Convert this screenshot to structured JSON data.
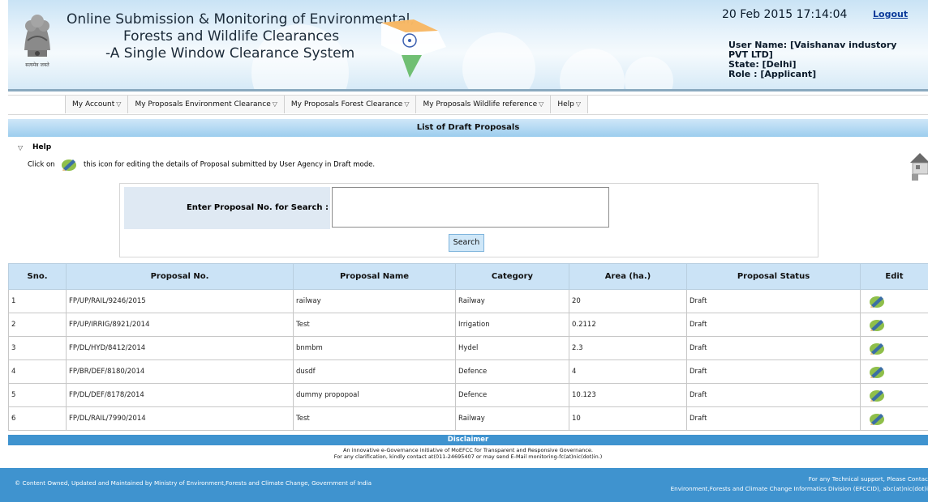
{
  "header": {
    "title_lines": [
      "Online Submission & Monitoring of Environmental,",
      "Forests and Wildlife Clearances",
      "-A Single Window Clearance System"
    ],
    "emblem_caption": "सत्यमेव जयते",
    "datetime": "20 Feb 2015 17:14:04",
    "logout_label": "Logout",
    "user_name": "User Name: [Vaishanav industory",
    "user_name_cont": "PVT LTD]",
    "state": "State: [Delhi]",
    "role": "Role : [Applicant]"
  },
  "menu": [
    {
      "label": "My Account",
      "icon": "chevron-down-icon"
    },
    {
      "label": "My Proposals Environment Clearance",
      "icon": "chevron-down-icon"
    },
    {
      "label": "My Proposals Forest Clearance",
      "icon": "chevron-down-icon"
    },
    {
      "label": "My Proposals Wildlife reference",
      "icon": "chevron-down-icon"
    },
    {
      "label": "Help",
      "icon": "chevron-down-icon"
    }
  ],
  "section_title": "List of Draft Proposals",
  "help": {
    "title": "Help",
    "text_before": "Click on",
    "text_after": "this icon for editing the details of Proposal submitted by User Agency in Draft mode."
  },
  "search": {
    "label": "Enter Proposal No. for Search :",
    "value": "",
    "button_label": "Search"
  },
  "table": {
    "headers": [
      "Sno.",
      "Proposal No.",
      "Proposal Name",
      "Category",
      "Area (ha.)",
      "Proposal Status",
      "Edit"
    ],
    "rows": [
      {
        "sno": "1",
        "proposal_no": "FP/UP/RAIL/9246/2015",
        "name": "railway",
        "category": "Railway",
        "area": "20",
        "status": "Draft"
      },
      {
        "sno": "2",
        "proposal_no": "FP/UP/IRRIG/8921/2014",
        "name": "Test",
        "category": "Irrigation",
        "area": "0.2112",
        "status": "Draft"
      },
      {
        "sno": "3",
        "proposal_no": "FP/DL/HYD/8412/2014",
        "name": "bnmbm",
        "category": "Hydel",
        "area": "2.3",
        "status": "Draft"
      },
      {
        "sno": "4",
        "proposal_no": "FP/BR/DEF/8180/2014",
        "name": "dusdf",
        "category": "Defence",
        "area": "4",
        "status": "Draft"
      },
      {
        "sno": "5",
        "proposal_no": "FP/DL/DEF/8178/2014",
        "name": "dummy propopoal",
        "category": "Defence",
        "area": "10.123",
        "status": "Draft"
      },
      {
        "sno": "6",
        "proposal_no": "FP/DL/RAIL/7990/2014",
        "name": "Test",
        "category": "Railway",
        "area": "10",
        "status": "Draft"
      }
    ]
  },
  "disclaimer": {
    "title": "Disclaimer",
    "line1": "An innovative e-Governance initiative of MoEFCC for Transparent and Responsive Governance.",
    "line2": "For any clarification, kindly contact at(011-24695407 or may send E-Mail monitoring-fc(at)nic(dot)in.)"
  },
  "footer": {
    "left": "© Content Owned, Updated and Maintained by Ministry of Environment,Forests and Climate Change, Government of India",
    "right_line1": "For any Technical support, Please Contac",
    "right_line2": "Environment,Forests and Climate Change Informatics Division (EFCCID), abc(at)nic(dot)i"
  },
  "colors": {
    "header_bg": "#d7eaf7",
    "section_bar": "#9ccdee",
    "table_header": "#cbe3f6",
    "footer_bg": "#3f93cf",
    "link": "#0b3a9a"
  }
}
